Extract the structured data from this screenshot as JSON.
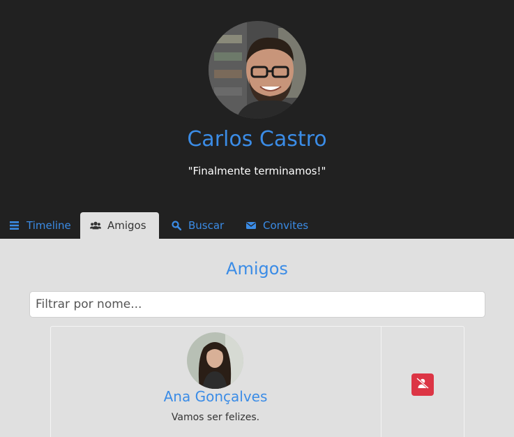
{
  "profile": {
    "name": "Carlos Castro",
    "status": "\"Finalmente terminamos!\""
  },
  "tabs": [
    {
      "label": "Timeline",
      "icon": "list-icon",
      "active": false
    },
    {
      "label": "Amigos",
      "icon": "users-icon",
      "active": true
    },
    {
      "label": "Buscar",
      "icon": "search-icon",
      "active": false
    },
    {
      "label": "Convites",
      "icon": "envelope-icon",
      "active": false
    }
  ],
  "friends_section": {
    "title": "Amigos",
    "filter_placeholder": "Filtrar por nome..."
  },
  "friends": [
    {
      "name": "Ana Gonçalves",
      "status": "Vamos ser felizes.",
      "action_icon": "user-remove-icon"
    }
  ],
  "colors": {
    "header_bg": "#212121",
    "accent": "#3b8ce6",
    "content_bg": "#e0e0e0",
    "danger": "#dc3545"
  }
}
